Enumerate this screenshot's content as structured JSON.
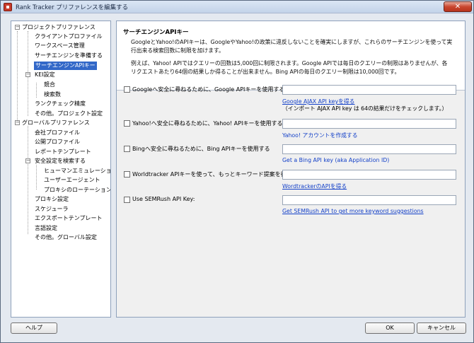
{
  "window": {
    "title": "Rank Tracker プリファレンスを編集する",
    "close_label": "✕"
  },
  "tree": {
    "items": [
      {
        "label": "プロジェクトプリファレンス"
      },
      {
        "label": "クライアントプロファイル"
      },
      {
        "label": "ワークスペース管理"
      },
      {
        "label": "サーチエンジンを準備する"
      },
      {
        "label": "サーチエンジンAPIキー"
      },
      {
        "label": "KEI設定"
      },
      {
        "label": "競合"
      },
      {
        "label": "検索数"
      },
      {
        "label": "ランクチェック精度"
      },
      {
        "label": "その他。プロジェクト設定"
      },
      {
        "label": "グローバルプリファレンス"
      },
      {
        "label": "会社プロファイル"
      },
      {
        "label": "公開プロファイル"
      },
      {
        "label": "レポートテンプレート"
      },
      {
        "label": "安全設定を検索する"
      },
      {
        "label": "ヒューマンエミュレーション"
      },
      {
        "label": "ユーザーエージェント"
      },
      {
        "label": "プロキシのローテーション"
      },
      {
        "label": "プロキシ設定"
      },
      {
        "label": "スケジューラ"
      },
      {
        "label": "エクスポートテンプレート"
      },
      {
        "label": "言語設定"
      },
      {
        "label": "その他。グローバル設定"
      }
    ]
  },
  "content": {
    "title": "サーチエンジンAPIキー",
    "desc1_line1": "GoogleとYahoo!のAPIキーは、GoogleやYahoo!の政策に違反しないことを確実にしますが、これらのサーチエンジンを使って実",
    "desc1_line2": "行出来る検索回数に制限を加けます。",
    "desc2_line1": "例えば、Yahoo! APIではクエリーの回数は5,000回に制限されます。Google APIでは毎日のクエリーの制限はありませんが、各",
    "desc2_line2": "リクエストあたり64個の結果しか得ることが出来ません。Bing APIの毎日のクエリー制限は10,000回です。",
    "options": [
      {
        "label": "Googleへ安全に尋ねるために、Google APIキーを使用する",
        "value": "",
        "link": "Google AJAX API keyを得る",
        "note": "（インポート AJAX API key は 64の結果だけをチェックします。）"
      },
      {
        "label": "Yahoo!へ安全に尋ねるために、Yahoo! APIキーを使用する",
        "value": "",
        "link": "Yahoo! アカウントを作成する",
        "note": ""
      },
      {
        "label": "Bingへ安全に尋ねるために、Bing APIキーを使用する",
        "value": "",
        "link": "Get a Bing API key (aka Application ID)",
        "note": ""
      },
      {
        "label": "Worldtracker APIキーを使って、もっとキーワード提案を得る",
        "value": "",
        "link": "WordtrackerのAPIを得る",
        "note": ""
      },
      {
        "label": "Use SEMRush API Key:",
        "value": "",
        "link": "Get SEMRush API to get more keyword suggestions",
        "note": ""
      }
    ]
  },
  "buttons": {
    "help": "ヘルプ",
    "ok": "OK",
    "cancel": "キャンセル"
  }
}
